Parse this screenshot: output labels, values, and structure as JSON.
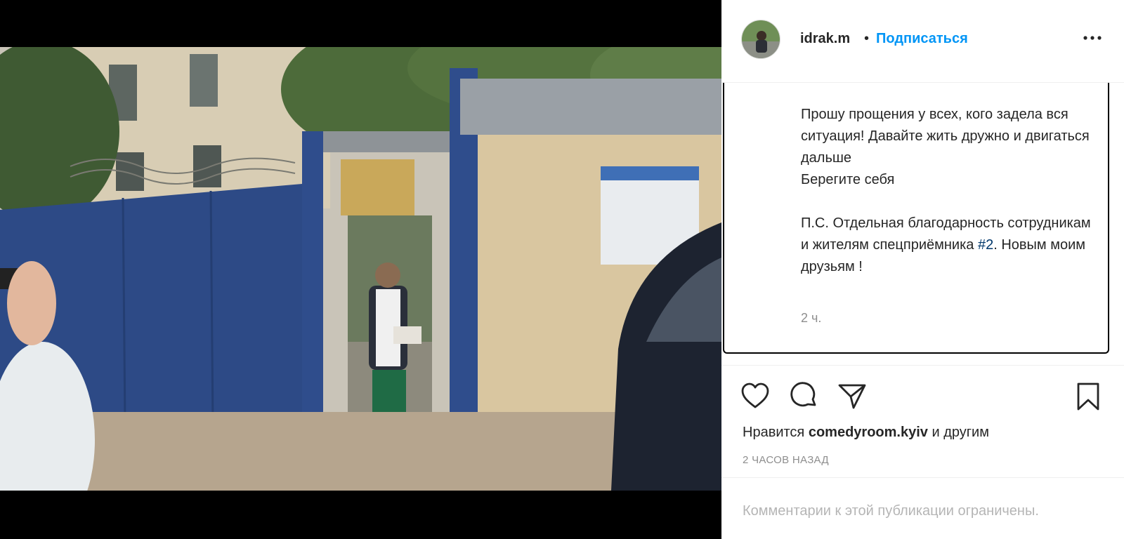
{
  "post": {
    "username": "idrak.m",
    "separator": "•",
    "follow_label": "Подписаться",
    "more_icon": "more-options-icon"
  },
  "caption": {
    "text_part1": "Прошу прощения у всех, кого задела вся ситуация! Давайте жить дружно и двигаться дальше\nБерегите себя\n\nП.С. Отдельная благодарность сотрудникам и жителям спецприёмника ",
    "hashtag": "#2",
    "text_part2": ". Новым моим друзьям !",
    "time": "2 ч."
  },
  "actions": {
    "like_icon": "heart-icon",
    "comment_icon": "comment-icon",
    "share_icon": "share-icon",
    "save_icon": "bookmark-icon",
    "likes_prefix": "Нравится",
    "likes_user": "comedyroom.kyiv",
    "likes_suffix": "и другим",
    "posted_ago": "2 ЧАСОВ НАЗАД"
  },
  "comments": {
    "disabled_note": "Комментарии к этой публикации ограничены."
  },
  "colors": {
    "accent": "#0095f6",
    "text": "#262626",
    "muted": "#8e8e8e",
    "hashtag": "#00376b"
  }
}
